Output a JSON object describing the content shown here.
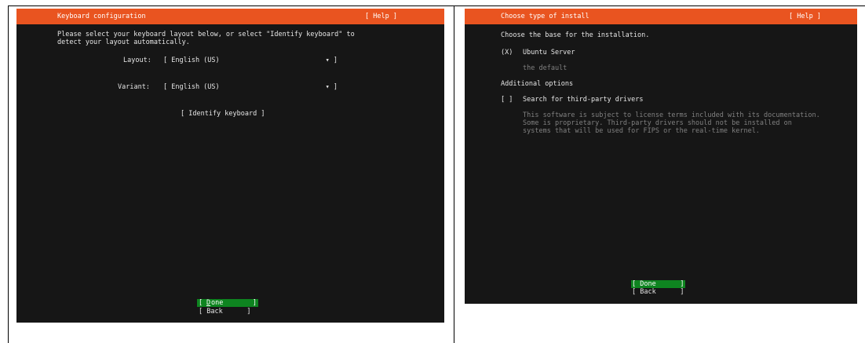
{
  "left": {
    "title": "Keyboard configuration",
    "help": "[ Help ]",
    "instructions_line1": "Please select your keyboard layout below, or select \"Identify keyboard\" to",
    "instructions_line2": "detect your layout automatically.",
    "layout_label": "Layout:",
    "layout_value": "[ English (US)",
    "layout_arrow": "▾ ]",
    "variant_label": "Variant:",
    "variant_value": "[ English (US)",
    "variant_arrow": "▾ ]",
    "identify_button": "[ Identify keyboard ]",
    "done_button": {
      "open": "[ ",
      "mnemonic": "D",
      "rest": "one",
      "close": "]"
    },
    "back_button": "[ Back      ]"
  },
  "right": {
    "title": "Choose type of install",
    "help": "[ Help ]",
    "base_heading": "Choose the base for the installation.",
    "option_server_radio": "(X)",
    "option_server_label": "Ubuntu Server",
    "option_server_desc": "the default",
    "additional_heading": "Additional options",
    "drivers_checkbox": "[ ]",
    "drivers_label": "Search for third-party drivers",
    "drivers_desc_line1": "This software is subject to license terms included with its documentation.",
    "drivers_desc_line2": "Some is proprietary. Third-party drivers should not be installed on",
    "drivers_desc_line3": "systems that will be used for FIPS or the real-time kernel.",
    "done_button": "[ Done      ]",
    "back_button": "[ Back      ]"
  },
  "colors": {
    "titlebar": "#e95420",
    "terminal_bg": "#161616",
    "focus_green": "#0e8420"
  }
}
